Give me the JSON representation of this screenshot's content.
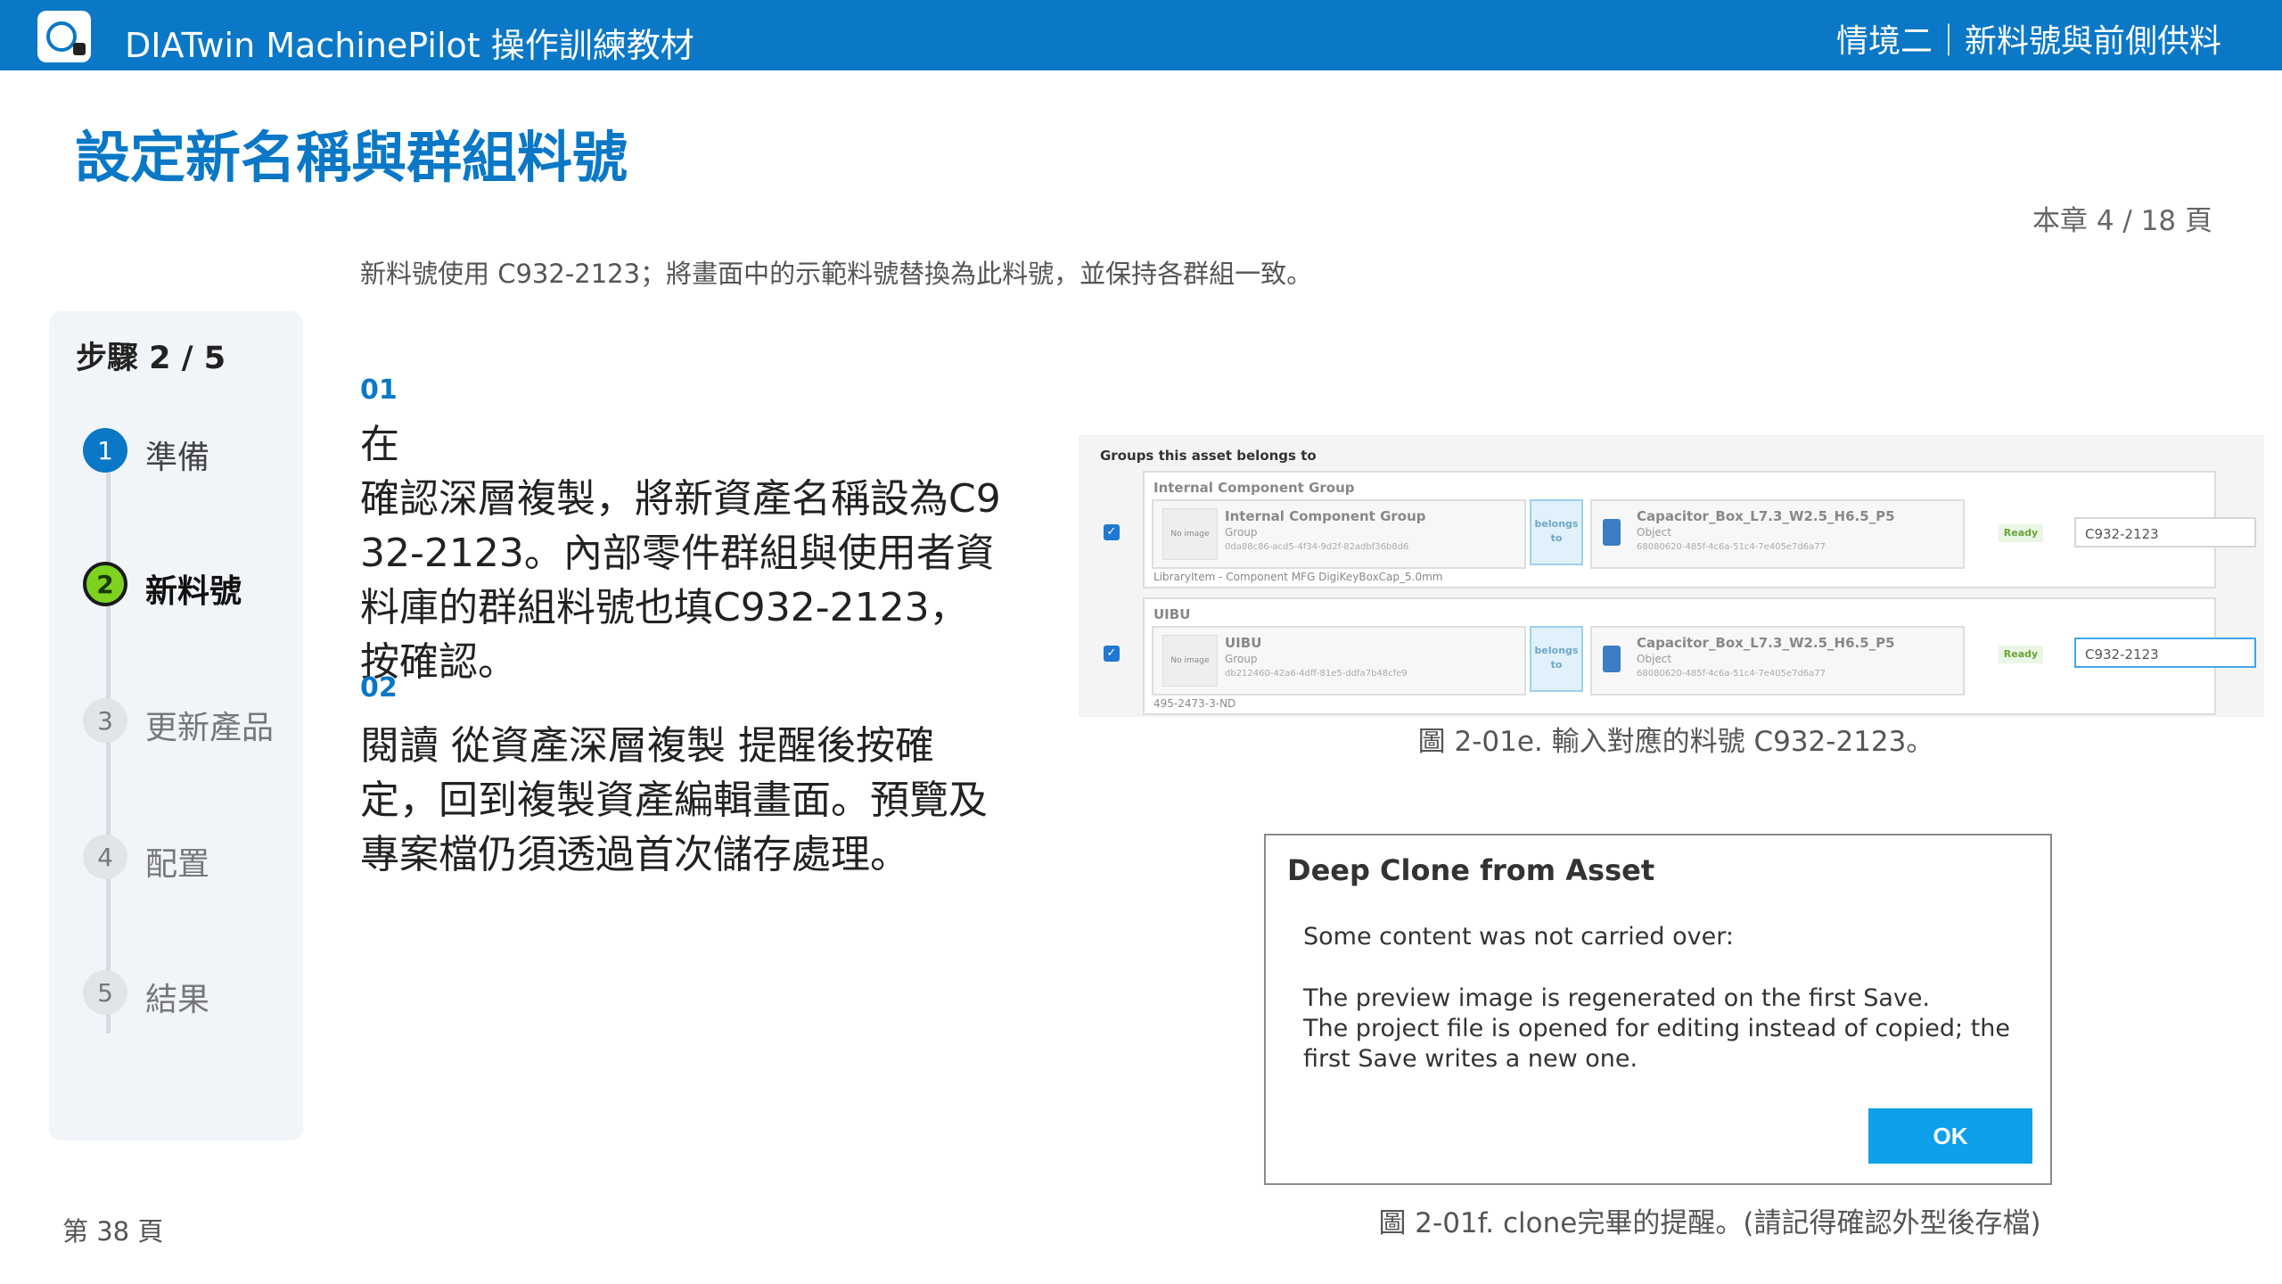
{
  "header": {
    "app_title": "DIATwin MachinePilot 操作訓練教材",
    "scenario": "情境二｜新料號與前側供料"
  },
  "page": {
    "title": "設定新名稱與群組料號",
    "chapter_page": "本章 4 / 18 頁",
    "instruction": "新料號使用 C932-2123；將畫面中的示範料號替換為此料號，並保持各群組一致。",
    "footer_page": "第 38 頁"
  },
  "steps": {
    "heading": "步驟 2 / 5",
    "items": [
      {
        "num": "1",
        "label": "準備"
      },
      {
        "num": "2",
        "label": "新料號"
      },
      {
        "num": "3",
        "label": "更新產品"
      },
      {
        "num": "4",
        "label": "配置"
      },
      {
        "num": "5",
        "label": "結果"
      }
    ]
  },
  "content": {
    "items": [
      {
        "num": "01",
        "text": "在\n確認深層複製，將新資產名稱設為C932-2123。內部零件群組與使用者資料庫的群組料號也填C932-2123，按確認。"
      },
      {
        "num": "02",
        "text": "閱讀 從資產深層複製 提醒後按確定，回到複製資產編輯畫面。預覽及專案檔仍須透過首次儲存處理。"
      }
    ]
  },
  "figure_groups": {
    "heading": "Groups this asset belongs to",
    "groups": [
      {
        "name": "Internal Component Group",
        "group_card": {
          "no_image": "No image",
          "title": "Internal Component Group",
          "subtitle": "Group",
          "id": "0da88c86-acd5-4f34-9d2f-82adbf36b8d6"
        },
        "belongs": "belongs to",
        "object_card": {
          "title": "Capacitor_Box_L7.3_W2.5_H6.5_P5",
          "subtitle": "Object",
          "id": "68080620-485f-4c6a-51c4-7e405e7d6a77"
        },
        "library": "LibraryItem - Component MFG DigiKeyBoxCap_5.0mm",
        "status": "Ready",
        "part_number": "C932-2123"
      },
      {
        "name": "UIBU",
        "group_card": {
          "no_image": "No image",
          "title": "UIBU",
          "subtitle": "Group",
          "id": "db212460-42a6-4dff-81e5-ddfa7b48cfe9"
        },
        "belongs": "belongs to",
        "object_card": {
          "title": "Capacitor_Box_L7.3_W2.5_H6.5_P5",
          "subtitle": "Object",
          "id": "68080620-485f-4c6a-51c4-7e405e7d6a77"
        },
        "library": "495-2473-3-ND",
        "status": "Ready",
        "part_number": "C932-2123"
      }
    ],
    "caption": "圖 2-01e. 輸入對應的料號 C932-2123。"
  },
  "figure_dialog": {
    "title": "Deep Clone from Asset",
    "message": "Some content was not carried over:",
    "body": "The preview image is regenerated on the first Save.\nThe project file is opened for editing instead of copied; the first Save writes a new one.",
    "ok_label": "OK",
    "caption": "圖 2-01f. clone完畢的提醒。(請記得確認外型後存檔)"
  },
  "colors": {
    "brand": "#0a78c6",
    "active_step": "#7ed320",
    "ok_button": "#0fa0ea"
  }
}
